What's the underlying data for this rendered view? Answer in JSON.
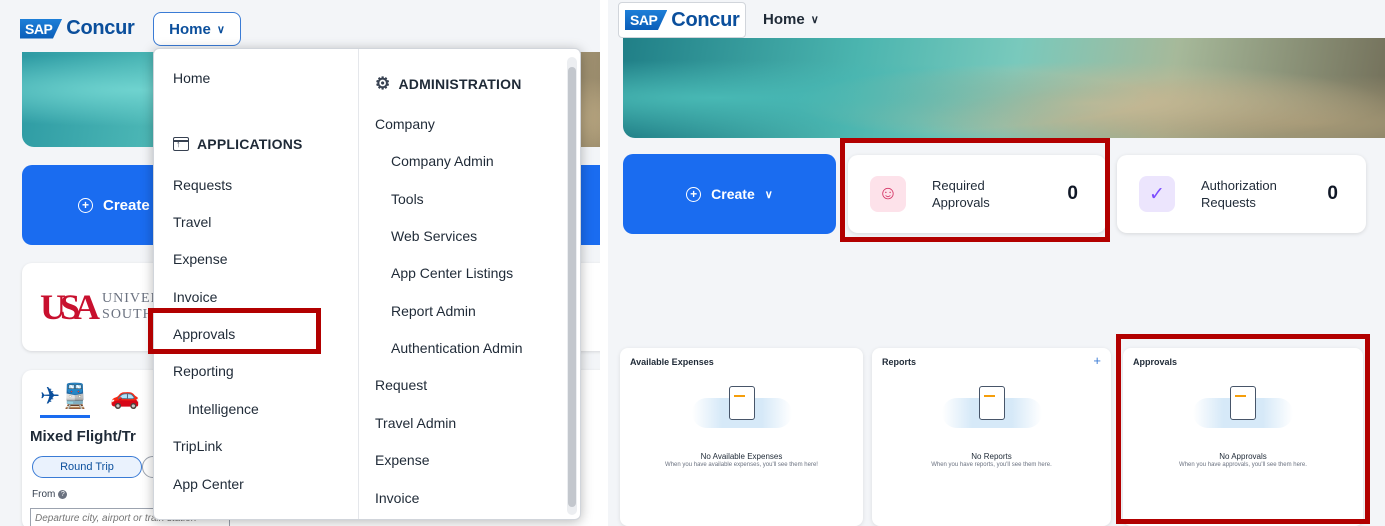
{
  "brand": {
    "sap": "SAP",
    "concur": "Concur"
  },
  "left": {
    "home_label": "Home",
    "create_label": "Create",
    "uni": {
      "mark": "USA",
      "line1": "UNIVER",
      "line2": "SOUTH"
    },
    "travel": {
      "title": "Mixed Flight/Tr",
      "round_trip": "Round Trip",
      "from_label": "From",
      "from_placeholder": "Departure city, airport or train station"
    },
    "menu": {
      "home": "Home",
      "applications_heading": "APPLICATIONS",
      "applications": [
        "Requests",
        "Travel",
        "Expense",
        "Invoice",
        "Approvals",
        "Reporting",
        "Intelligence",
        "TripLink",
        "App Center"
      ],
      "administration_heading": "ADMINISTRATION",
      "administration": [
        "Company",
        "Company Admin",
        "Tools",
        "Web Services",
        "App Center Listings",
        "Report Admin",
        "Authentication Admin",
        "Request",
        "Travel Admin",
        "Expense",
        "Invoice"
      ]
    }
  },
  "right": {
    "home_label": "Home",
    "create_label": "Create",
    "stats": [
      {
        "label": "Required Approvals",
        "count": "0"
      },
      {
        "label": "Authorization Requests",
        "count": "0"
      }
    ],
    "tiles": [
      {
        "title": "Available Expenses",
        "main": "No Available Expenses",
        "sub": "When you have available expenses, you'll see them here!"
      },
      {
        "title": "Reports",
        "main": "No Reports",
        "sub": "When you have reports, you'll see them here."
      },
      {
        "title": "Approvals",
        "main": "No Approvals",
        "sub": "When you have approvals, you'll see them here."
      }
    ]
  },
  "colors": {
    "primary_blue": "#1a6cf0",
    "highlight_red": "#b20000",
    "brand_blue": "#0b4f9c"
  }
}
